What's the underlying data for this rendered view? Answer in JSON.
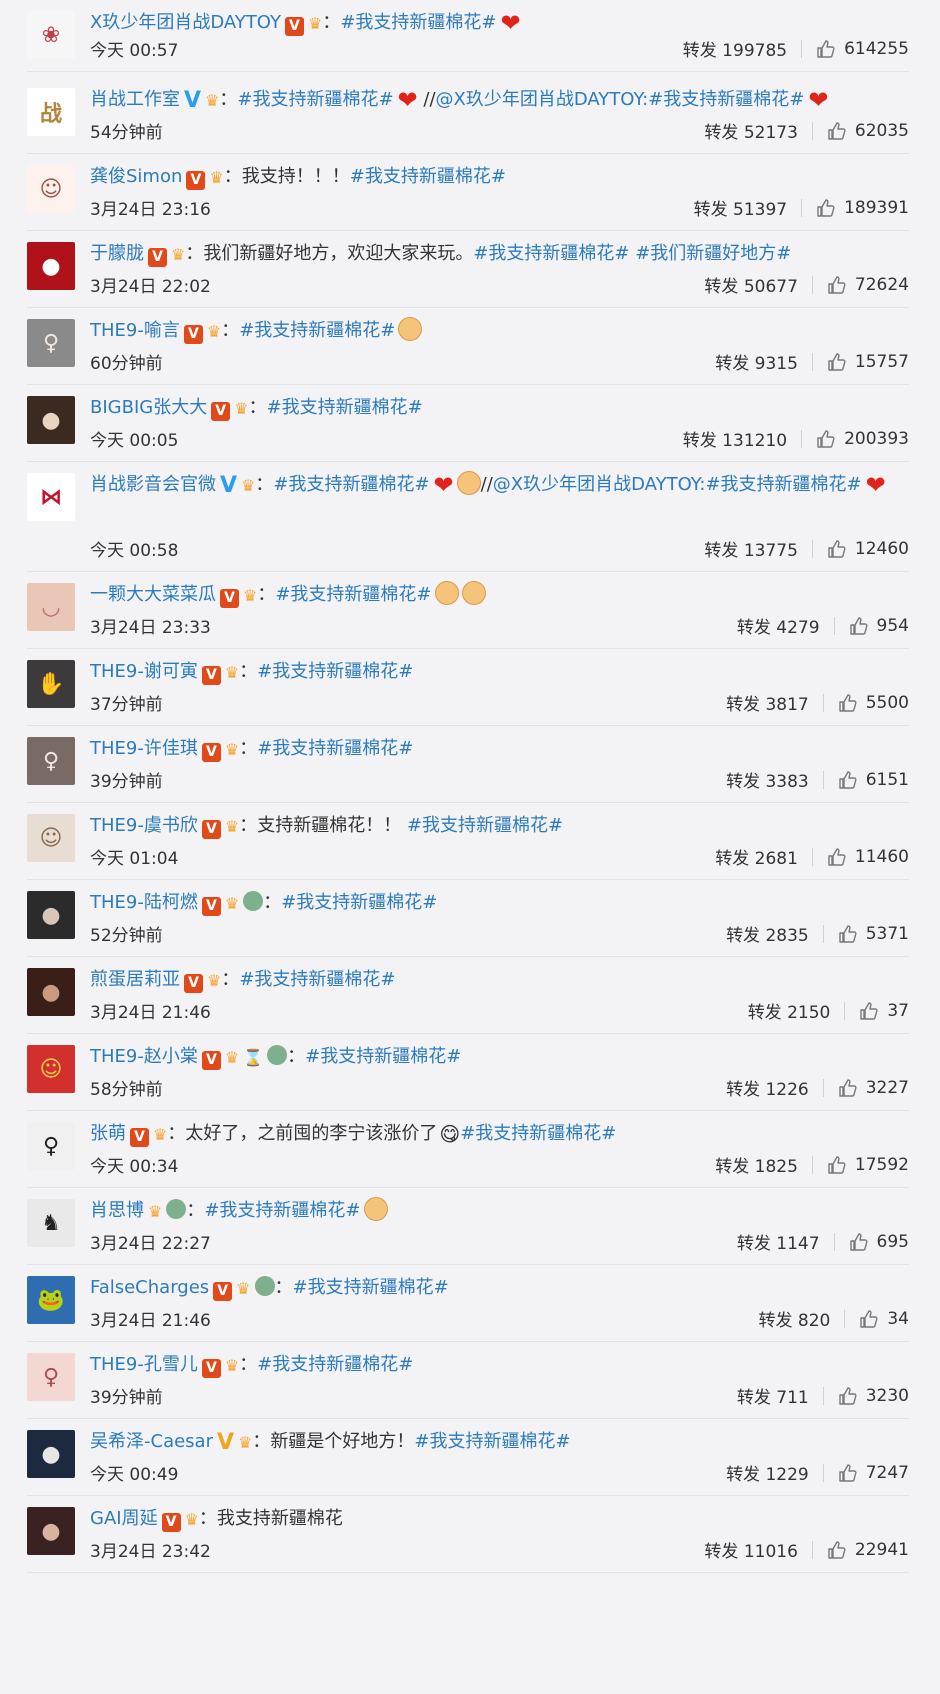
{
  "items": [
    {
      "name": "X玖少年团肖战DAYTOY",
      "verified": "red",
      "extra": [],
      "colon": "：",
      "text": "",
      "topic": "#我支持新疆棉花#",
      "after": [
        "heart"
      ],
      "time": "今天 00:57",
      "repost": "转发 199785",
      "likes": "614255",
      "avatar": {
        "bg": "#f6f6f6",
        "fg": "#c0404a",
        "glyph": "❀"
      }
    },
    {
      "name": "肖战工作室",
      "verified": "blue",
      "extra": [],
      "colon": "：",
      "text": "",
      "topic": "#我支持新疆棉花#",
      "after": [
        "heart"
      ],
      "tail_plain": " //",
      "tail_link": "@X玖少年团肖战DAYTOY",
      "tail_sep": ":",
      "tail_topic": "#我支持新疆棉花#",
      "tail_after": [
        "heart"
      ],
      "time": "54分钟前",
      "repost": "转发 52173",
      "likes": "62035",
      "avatar": {
        "bg": "#ffffff",
        "fg": "#b6833a",
        "glyph": "战"
      }
    },
    {
      "name": "龚俊Simon",
      "verified": "red",
      "extra": [],
      "colon": "：",
      "text": "我支持！！！",
      "topic": "#我支持新疆棉花#",
      "after": [],
      "time": "3月24日 23:16",
      "repost": "转发 51397",
      "likes": "189391",
      "avatar": {
        "bg": "#fdf2ee",
        "fg": "#a05540",
        "glyph": "☺"
      }
    },
    {
      "name": "于朦胧",
      "verified": "red",
      "extra": [],
      "colon": "：",
      "text": "我们新疆好地方，欢迎大家来玩。",
      "topic": "#我支持新疆棉花# #我们新疆好地方#",
      "after": [],
      "time": "3月24日 22:02",
      "repost": "转发 50677",
      "likes": "72624",
      "avatar": {
        "bg": "#b0121a",
        "fg": "#ffffff",
        "glyph": "●"
      }
    },
    {
      "name": "THE9-喻言",
      "verified": "red",
      "extra": [],
      "colon": "：",
      "text": "",
      "topic": "#我支持新疆棉花#",
      "after": [
        "fist"
      ],
      "time": "60分钟前",
      "repost": "转发 9315",
      "likes": "15757",
      "avatar": {
        "bg": "#8a8a8a",
        "fg": "#f0e6dd",
        "glyph": "♀"
      }
    },
    {
      "name": "BIGBIG张大大",
      "verified": "red",
      "extra": [],
      "colon": "：",
      "text": "",
      "topic": "#我支持新疆棉花#",
      "after": [],
      "time": "今天 00:05",
      "repost": "转发 131210",
      "likes": "200393",
      "avatar": {
        "bg": "#3a2a20",
        "fg": "#e8d4c0",
        "glyph": "●"
      }
    },
    {
      "name": "肖战影音会官微",
      "verified": "blue",
      "extra": [],
      "colon": "：",
      "text": "",
      "topic": "#我支持新疆棉花#",
      "after": [
        "heart",
        "fist"
      ],
      "tail_plain": "//",
      "tail_link": "@X玖少年团肖战DAYTOY",
      "tail_sep": ":",
      "tail_topic": "#我支持新疆棉花#",
      "tail_after": [
        "heart"
      ],
      "wrap": true,
      "time": "今天 00:58",
      "repost": "转发 13775",
      "likes": "12460",
      "avatar": {
        "bg": "#ffffff",
        "fg": "#c8102e",
        "glyph": "⋈"
      }
    },
    {
      "name": "一颗大大菜菜瓜",
      "verified": "red",
      "extra": [],
      "colon": "：",
      "text": "",
      "topic": "#我支持新疆棉花#",
      "after": [
        "fist",
        "fist"
      ],
      "time": "3月24日 23:33",
      "repost": "转发 4279",
      "likes": "954",
      "avatar": {
        "bg": "#e9c6b6",
        "fg": "#b26b5d",
        "glyph": "◡"
      }
    },
    {
      "name": "THE9-谢可寅",
      "verified": "red",
      "extra": [],
      "colon": "：",
      "text": "",
      "topic": "#我支持新疆棉花#",
      "after": [],
      "time": "37分钟前",
      "repost": "转发 3817",
      "likes": "5500",
      "avatar": {
        "bg": "#3c3a3a",
        "fg": "#eadad0",
        "glyph": "✋"
      }
    },
    {
      "name": "THE9-许佳琪",
      "verified": "red",
      "extra": [],
      "colon": "：",
      "text": "",
      "topic": "#我支持新疆棉花#",
      "after": [],
      "time": "39分钟前",
      "repost": "转发 3383",
      "likes": "6151",
      "avatar": {
        "bg": "#7a6a66",
        "fg": "#f1e6df",
        "glyph": "♀"
      }
    },
    {
      "name": "THE9-虞书欣",
      "verified": "red",
      "extra": [],
      "colon": "：",
      "text": "支持新疆棉花！！ ",
      "topic": "#我支持新疆棉花#",
      "after": [],
      "time": "今天 01:04",
      "repost": "转发 2681",
      "likes": "11460",
      "avatar": {
        "bg": "#e8ddd2",
        "fg": "#8a6b4c",
        "glyph": "☺"
      }
    },
    {
      "name": "THE9-陆柯燃",
      "verified": "red",
      "extra": [
        "person"
      ],
      "colon": "：",
      "text": "",
      "topic": "#我支持新疆棉花#",
      "after": [],
      "time": "52分钟前",
      "repost": "转发 2835",
      "likes": "5371",
      "avatar": {
        "bg": "#2b2b2b",
        "fg": "#d8c7b8",
        "glyph": "●"
      }
    },
    {
      "name": "煎蛋居莉亚",
      "verified": "red",
      "extra": [],
      "colon": "：",
      "text": "",
      "topic": "#我支持新疆棉花#",
      "after": [],
      "time": "3月24日 21:46",
      "repost": "转发 2150",
      "likes": "37",
      "avatar": {
        "bg": "#3a1f18",
        "fg": "#c99a80",
        "glyph": "●"
      }
    },
    {
      "name": "THE9-赵小棠",
      "verified": "red",
      "extra": [
        "hourglass",
        "person"
      ],
      "colon": "：",
      "text": "",
      "topic": "#我支持新疆棉花#",
      "after": [],
      "time": "58分钟前",
      "repost": "转发 1226",
      "likes": "3227",
      "avatar": {
        "bg": "#d1302e",
        "fg": "#ffd24a",
        "glyph": "☺"
      }
    },
    {
      "name": "张萌",
      "verified": "red",
      "extra": [],
      "colon": "：",
      "text": "太好了，之前囤的李宁该涨价了",
      "topic": "#我支持新疆棉花#",
      "after_text": [
        "smile"
      ],
      "after": [],
      "time": "今天 00:34",
      "repost": "转发 1825",
      "likes": "17592",
      "avatar": {
        "bg": "#f0f0f0",
        "fg": "#222222",
        "glyph": "♀"
      }
    },
    {
      "name": "肖思博",
      "verified": "none",
      "extra": [
        "person"
      ],
      "colon": "：",
      "text": "",
      "topic": "#我支持新疆棉花#",
      "after": [
        "fist"
      ],
      "time": "3月24日 22:27",
      "repost": "转发 1147",
      "likes": "695",
      "avatar": {
        "bg": "#e9e9e9",
        "fg": "#222222",
        "glyph": "♞"
      }
    },
    {
      "name": "FalseCharges",
      "verified": "red",
      "extra": [
        "person"
      ],
      "colon": "：",
      "text": "",
      "topic": "#我支持新疆棉花#",
      "after": [],
      "time": "3月24日 21:46",
      "repost": "转发 820",
      "likes": "34",
      "avatar": {
        "bg": "#2f6db0",
        "fg": "#4fa650",
        "glyph": "🐸"
      }
    },
    {
      "name": "THE9-孔雪儿",
      "verified": "red",
      "extra": [],
      "colon": "：",
      "text": "",
      "topic": "#我支持新疆棉花#",
      "after": [],
      "time": "39分钟前",
      "repost": "转发 711",
      "likes": "3230",
      "avatar": {
        "bg": "#f2d8d0",
        "fg": "#b34a55",
        "glyph": "♀"
      }
    },
    {
      "name": "吴希泽-Caesar",
      "verified": "gold",
      "extra": [],
      "colon": "：",
      "text": "新疆是个好地方！",
      "topic": "#我支持新疆棉花#",
      "after": [],
      "time": "今天 00:49",
      "repost": "转发 1229",
      "likes": "7247",
      "avatar": {
        "bg": "#1c2a40",
        "fg": "#e6e6e6",
        "glyph": "●"
      }
    },
    {
      "name": "GAI周延",
      "verified": "red",
      "extra": [],
      "colon": "：",
      "text": "我支持新疆棉花",
      "topic": "",
      "after": [],
      "time": "3月24日 23:42",
      "repost": "转发 11016",
      "likes": "22941",
      "avatar": {
        "bg": "#3a2222",
        "fg": "#d9b2a0",
        "glyph": "●"
      }
    }
  ],
  "badge_v_label": "V",
  "colors": {
    "link": "#2d7bbf",
    "text": "#333333",
    "bg": "#f3f3f5",
    "verified_red": "#e04a1a",
    "verified_blue": "#2c9cf0",
    "verified_gold": "#f0a51c"
  }
}
